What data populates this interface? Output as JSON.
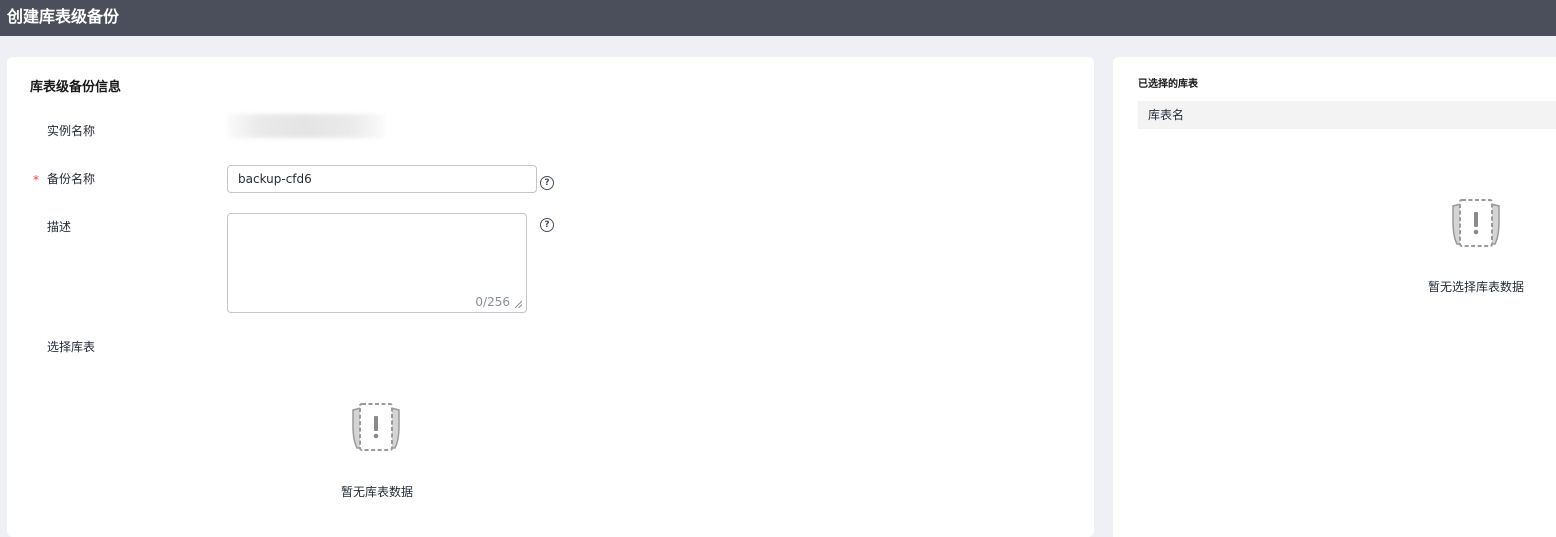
{
  "header": {
    "title": "创建库表级备份"
  },
  "form": {
    "section_title": "库表级备份信息",
    "instance_label": "实例名称",
    "required_mark": "*",
    "backup_name_label": "备份名称",
    "backup_name_value": "backup-cfd6",
    "description_label": "描述",
    "description_value": "",
    "description_counter": "0/256",
    "select_tables_label": "选择库表",
    "empty_text": "暂无库表数据"
  },
  "selected": {
    "title": "已选择的库表",
    "column_header": "库表名",
    "empty_text": "暂无选择库表数据"
  },
  "icons": {
    "help": "help-circle-icon",
    "empty": "empty-data-icon",
    "resize": "resize-handle-icon"
  },
  "colors": {
    "topbar": "#4b4f5c",
    "background": "#eef0f5",
    "required": "#e54545",
    "border": "#c2c5cc"
  }
}
